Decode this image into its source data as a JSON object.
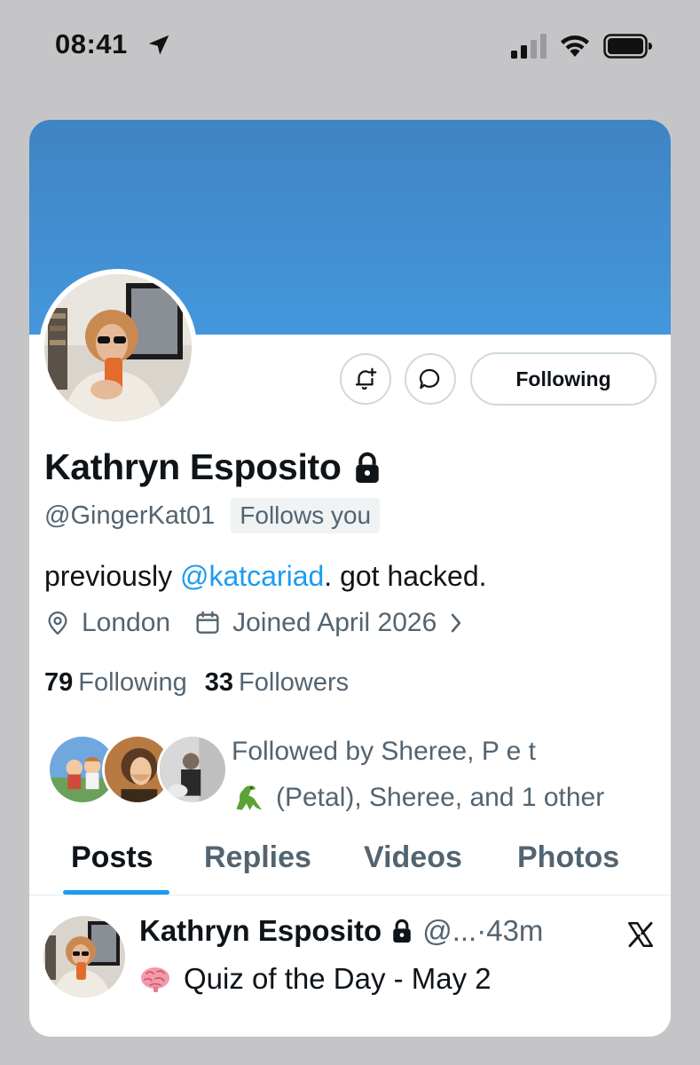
{
  "status_bar": {
    "time": "08:41",
    "icons": [
      "location-arrow-icon",
      "cellular-signal-icon",
      "wifi-icon",
      "battery-icon"
    ]
  },
  "profile": {
    "banner_color": "#4497dc",
    "display_name": "Kathryn Esposito",
    "handle": "@GingerKat01",
    "follows_you_label": "Follows you",
    "bio_prefix": "previously ",
    "bio_mention": "@katcariad",
    "bio_suffix": ". got hacked.",
    "location": "London",
    "joined": "Joined April 2026",
    "following_count": "79",
    "following_label": "Following",
    "followers_count": "33",
    "followers_label": "Followers",
    "followed_by_line1": "Followed by Sheree, P  e  t",
    "followed_by_line2": "(Petal), Sheree, and 1 other"
  },
  "actions": {
    "notify_icon": "bell-plus-icon",
    "message_icon": "chat-bubble-icon",
    "follow_state_label": "Following"
  },
  "tabs": [
    {
      "label": "Posts",
      "active": true
    },
    {
      "label": "Replies",
      "active": false
    },
    {
      "label": "Videos",
      "active": false
    },
    {
      "label": "Photos",
      "active": false
    }
  ],
  "post": {
    "author": "Kathryn Esposito",
    "handle_truncated": "@...",
    "separator": "·",
    "time": "43m",
    "text": "Quiz of the Day - May 2"
  },
  "colors": {
    "accent": "#1d9bf0",
    "secondary_text": "#536471",
    "primary_text": "#0f1419"
  }
}
